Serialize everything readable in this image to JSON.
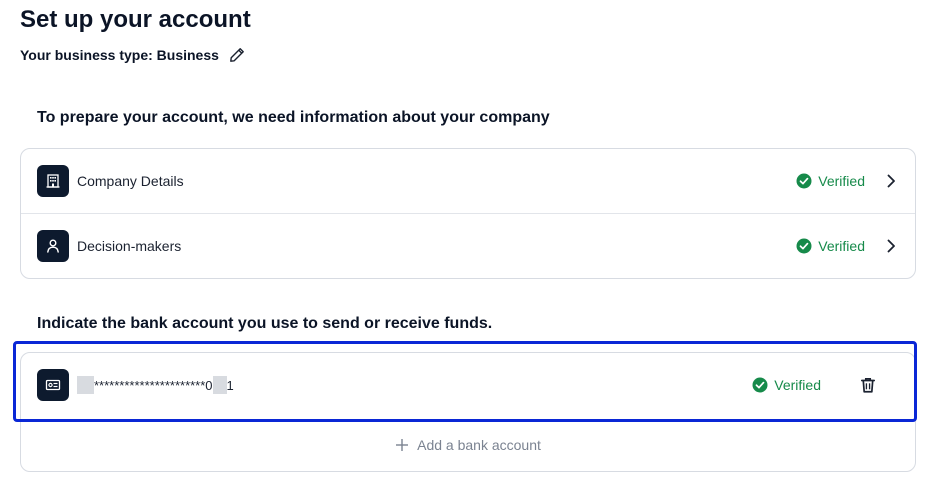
{
  "page": {
    "title": "Set up your account",
    "business_type": "Your business type: Business"
  },
  "company_section": {
    "title": "To prepare your account, we need information about your company",
    "items": [
      {
        "label": "Company Details",
        "status": "Verified",
        "icon": "building-icon"
      },
      {
        "label": "Decision-makers",
        "status": "Verified",
        "icon": "person-icon"
      }
    ]
  },
  "bank_section": {
    "title": "Indicate the bank account you use to send or receive funds.",
    "account": {
      "mask_middle": "**********************0",
      "mask_end": "1",
      "status": "Verified",
      "icon": "bank-card-icon"
    },
    "add_label": "Add a bank account"
  },
  "colors": {
    "verified": "#168a4a",
    "icon_bg": "#0d1a2e",
    "highlight": "#0a27d6"
  }
}
